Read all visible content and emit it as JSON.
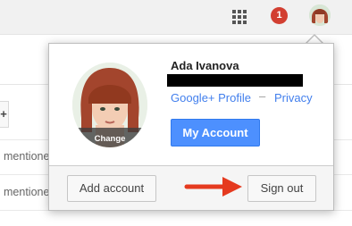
{
  "topbar": {
    "apps_icon": "apps-grid-icon",
    "notification_count": "1",
    "avatar_icon": "user-avatar-icon"
  },
  "background": {
    "tab_symbol": "+",
    "rows": [
      "mentione",
      "mentione"
    ]
  },
  "account_popup": {
    "name": "Ada Ivanova",
    "avatar_change_label": "Change",
    "google_plus_profile_link": "Google+ Profile",
    "separator": "–",
    "privacy_link": "Privacy",
    "my_account_button": "My Account",
    "add_account_button": "Add account",
    "sign_out_button": "Sign out"
  },
  "colors": {
    "accent_blue": "#4d90fe",
    "link_blue": "#427fed",
    "badge_red": "#d23f31",
    "arrow_red": "#e53a1f"
  }
}
